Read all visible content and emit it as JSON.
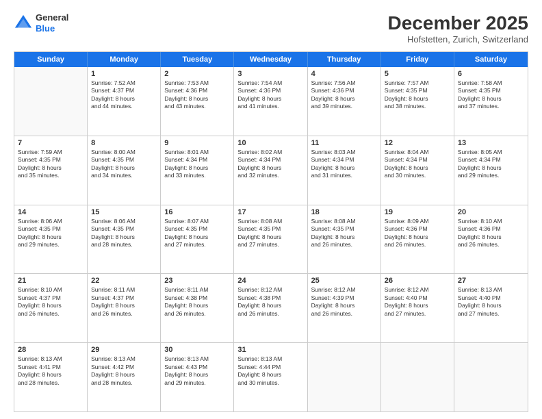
{
  "header": {
    "logo_line1": "General",
    "logo_line2": "Blue",
    "month": "December 2025",
    "location": "Hofstetten, Zurich, Switzerland"
  },
  "weekdays": [
    "Sunday",
    "Monday",
    "Tuesday",
    "Wednesday",
    "Thursday",
    "Friday",
    "Saturday"
  ],
  "weeks": [
    [
      {
        "day": "",
        "info": ""
      },
      {
        "day": "1",
        "info": "Sunrise: 7:52 AM\nSunset: 4:37 PM\nDaylight: 8 hours\nand 44 minutes."
      },
      {
        "day": "2",
        "info": "Sunrise: 7:53 AM\nSunset: 4:36 PM\nDaylight: 8 hours\nand 43 minutes."
      },
      {
        "day": "3",
        "info": "Sunrise: 7:54 AM\nSunset: 4:36 PM\nDaylight: 8 hours\nand 41 minutes."
      },
      {
        "day": "4",
        "info": "Sunrise: 7:56 AM\nSunset: 4:36 PM\nDaylight: 8 hours\nand 39 minutes."
      },
      {
        "day": "5",
        "info": "Sunrise: 7:57 AM\nSunset: 4:35 PM\nDaylight: 8 hours\nand 38 minutes."
      },
      {
        "day": "6",
        "info": "Sunrise: 7:58 AM\nSunset: 4:35 PM\nDaylight: 8 hours\nand 37 minutes."
      }
    ],
    [
      {
        "day": "7",
        "info": "Sunrise: 7:59 AM\nSunset: 4:35 PM\nDaylight: 8 hours\nand 35 minutes."
      },
      {
        "day": "8",
        "info": "Sunrise: 8:00 AM\nSunset: 4:35 PM\nDaylight: 8 hours\nand 34 minutes."
      },
      {
        "day": "9",
        "info": "Sunrise: 8:01 AM\nSunset: 4:34 PM\nDaylight: 8 hours\nand 33 minutes."
      },
      {
        "day": "10",
        "info": "Sunrise: 8:02 AM\nSunset: 4:34 PM\nDaylight: 8 hours\nand 32 minutes."
      },
      {
        "day": "11",
        "info": "Sunrise: 8:03 AM\nSunset: 4:34 PM\nDaylight: 8 hours\nand 31 minutes."
      },
      {
        "day": "12",
        "info": "Sunrise: 8:04 AM\nSunset: 4:34 PM\nDaylight: 8 hours\nand 30 minutes."
      },
      {
        "day": "13",
        "info": "Sunrise: 8:05 AM\nSunset: 4:34 PM\nDaylight: 8 hours\nand 29 minutes."
      }
    ],
    [
      {
        "day": "14",
        "info": "Sunrise: 8:06 AM\nSunset: 4:35 PM\nDaylight: 8 hours\nand 29 minutes."
      },
      {
        "day": "15",
        "info": "Sunrise: 8:06 AM\nSunset: 4:35 PM\nDaylight: 8 hours\nand 28 minutes."
      },
      {
        "day": "16",
        "info": "Sunrise: 8:07 AM\nSunset: 4:35 PM\nDaylight: 8 hours\nand 27 minutes."
      },
      {
        "day": "17",
        "info": "Sunrise: 8:08 AM\nSunset: 4:35 PM\nDaylight: 8 hours\nand 27 minutes."
      },
      {
        "day": "18",
        "info": "Sunrise: 8:08 AM\nSunset: 4:35 PM\nDaylight: 8 hours\nand 26 minutes."
      },
      {
        "day": "19",
        "info": "Sunrise: 8:09 AM\nSunset: 4:36 PM\nDaylight: 8 hours\nand 26 minutes."
      },
      {
        "day": "20",
        "info": "Sunrise: 8:10 AM\nSunset: 4:36 PM\nDaylight: 8 hours\nand 26 minutes."
      }
    ],
    [
      {
        "day": "21",
        "info": "Sunrise: 8:10 AM\nSunset: 4:37 PM\nDaylight: 8 hours\nand 26 minutes."
      },
      {
        "day": "22",
        "info": "Sunrise: 8:11 AM\nSunset: 4:37 PM\nDaylight: 8 hours\nand 26 minutes."
      },
      {
        "day": "23",
        "info": "Sunrise: 8:11 AM\nSunset: 4:38 PM\nDaylight: 8 hours\nand 26 minutes."
      },
      {
        "day": "24",
        "info": "Sunrise: 8:12 AM\nSunset: 4:38 PM\nDaylight: 8 hours\nand 26 minutes."
      },
      {
        "day": "25",
        "info": "Sunrise: 8:12 AM\nSunset: 4:39 PM\nDaylight: 8 hours\nand 26 minutes."
      },
      {
        "day": "26",
        "info": "Sunrise: 8:12 AM\nSunset: 4:40 PM\nDaylight: 8 hours\nand 27 minutes."
      },
      {
        "day": "27",
        "info": "Sunrise: 8:13 AM\nSunset: 4:40 PM\nDaylight: 8 hours\nand 27 minutes."
      }
    ],
    [
      {
        "day": "28",
        "info": "Sunrise: 8:13 AM\nSunset: 4:41 PM\nDaylight: 8 hours\nand 28 minutes."
      },
      {
        "day": "29",
        "info": "Sunrise: 8:13 AM\nSunset: 4:42 PM\nDaylight: 8 hours\nand 28 minutes."
      },
      {
        "day": "30",
        "info": "Sunrise: 8:13 AM\nSunset: 4:43 PM\nDaylight: 8 hours\nand 29 minutes."
      },
      {
        "day": "31",
        "info": "Sunrise: 8:13 AM\nSunset: 4:44 PM\nDaylight: 8 hours\nand 30 minutes."
      },
      {
        "day": "",
        "info": ""
      },
      {
        "day": "",
        "info": ""
      },
      {
        "day": "",
        "info": ""
      }
    ]
  ]
}
